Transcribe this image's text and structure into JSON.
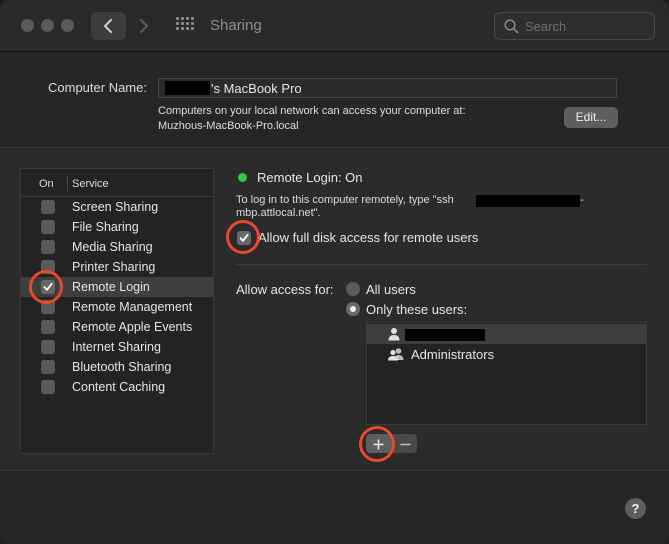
{
  "window": {
    "title": "Sharing"
  },
  "search": {
    "placeholder": "Search"
  },
  "computer_name": {
    "label": "Computer Name:",
    "value_suffix": "'s MacBook Pro",
    "description_line1": "Computers on your local network can access your computer at:",
    "description_line2": "Muzhous-MacBook-Pro.local",
    "edit_label": "Edit..."
  },
  "service_list": {
    "header_on": "On",
    "header_service": "Service",
    "items": [
      {
        "label": "Screen Sharing",
        "checked": false
      },
      {
        "label": "File Sharing",
        "checked": false
      },
      {
        "label": "Media Sharing",
        "checked": false
      },
      {
        "label": "Printer Sharing",
        "checked": false
      },
      {
        "label": "Remote Login",
        "checked": true,
        "selected": true
      },
      {
        "label": "Remote Management",
        "checked": false
      },
      {
        "label": "Remote Apple Events",
        "checked": false
      },
      {
        "label": "Internet Sharing",
        "checked": false
      },
      {
        "label": "Bluetooth Sharing",
        "checked": false
      },
      {
        "label": "Content Caching",
        "checked": false
      }
    ]
  },
  "remote_login": {
    "status": "Remote Login: On",
    "status_color": "#33c748",
    "hint_line1": "To log in to this computer remotely, type \"ssh",
    "hint_line1_tail": "-",
    "hint_line2": "mbp.attlocal.net\".",
    "full_disk_access_label": "Allow full disk access for remote users",
    "full_disk_access_checked": true
  },
  "access": {
    "label": "Allow access for:",
    "option_all": "All users",
    "option_only": "Only these users:",
    "selected": "Only these users:",
    "users": [
      {
        "label": "",
        "icon": "user-icon",
        "redacted": true
      },
      {
        "label": "Administrators",
        "icon": "group-icon"
      }
    ]
  },
  "buttons": {
    "add": "+",
    "remove": "−",
    "help": "?"
  },
  "annotation_color": "#e8492e"
}
